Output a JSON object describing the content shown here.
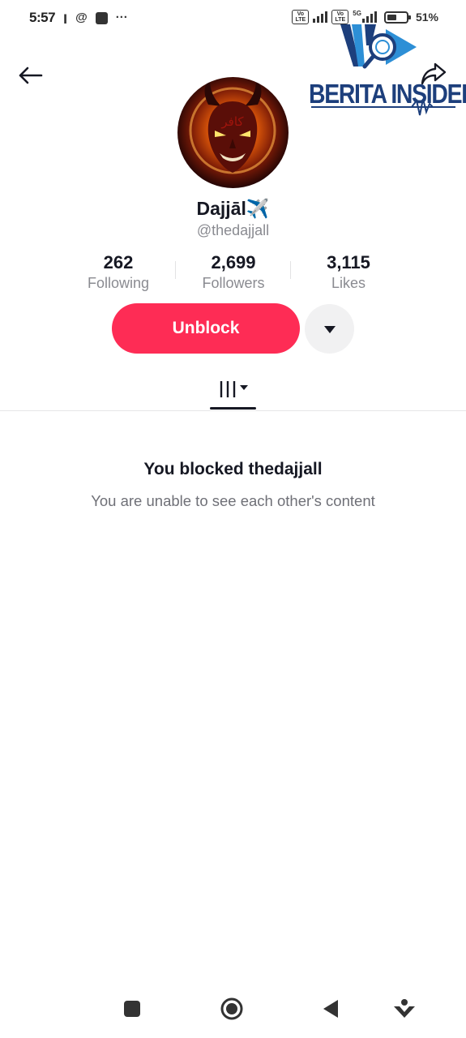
{
  "status_bar": {
    "time": "5:57",
    "battery_text": "51%",
    "volte_1": "Vo LTE",
    "volte_2": "Vo LTE",
    "network": "5G",
    "battery_level": 0.51
  },
  "watermark": {
    "text": "BERITA INSIDER",
    "color_primary": "#1d3f7c",
    "color_accent": "#2d8fd6"
  },
  "profile": {
    "display_name": "Dajjāl✈️",
    "username": "@thedajjall",
    "avatar_icon": "demon-avatar-image"
  },
  "stats": {
    "following_count": "262",
    "following_label": "Following",
    "followers_count": "2,699",
    "followers_label": "Followers",
    "likes_count": "3,115",
    "likes_label": "Likes"
  },
  "actions": {
    "unblock_label": "Unblock",
    "more_icon": "caret-down-icon",
    "accent_color": "#fe2c55"
  },
  "tabs": {
    "videos_icon": "grid-videos-icon"
  },
  "blocked": {
    "title": "You blocked thedajjall",
    "subtitle": "You are unable to see each other's content"
  },
  "nav_bar": {
    "items": [
      "recents-icon",
      "home-icon",
      "back-icon",
      "assistant-icon"
    ]
  }
}
